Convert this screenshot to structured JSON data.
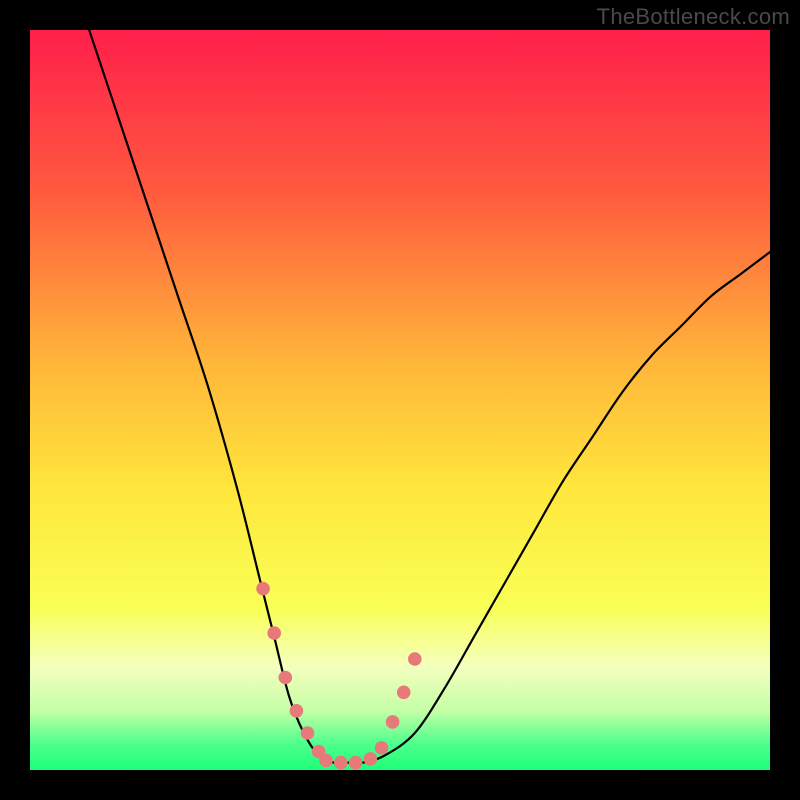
{
  "watermark": "TheBottleneck.com",
  "chart_data": {
    "type": "line",
    "title": "",
    "xlabel": "",
    "ylabel": "",
    "xlim": [
      0,
      100
    ],
    "ylim": [
      0,
      100
    ],
    "series": [
      {
        "name": "bottleneck-curve",
        "x": [
          8,
          12,
          16,
          20,
          24,
          28,
          31,
          33,
          35,
          37,
          39,
          41,
          43,
          45,
          48,
          52,
          56,
          60,
          64,
          68,
          72,
          76,
          80,
          84,
          88,
          92,
          96,
          100
        ],
        "y": [
          100,
          88,
          76,
          64,
          52,
          38,
          26,
          18,
          10,
          5,
          2,
          1,
          1,
          1,
          2,
          5,
          11,
          18,
          25,
          32,
          39,
          45,
          51,
          56,
          60,
          64,
          67,
          70
        ]
      }
    ],
    "markers": {
      "name": "highlight-dots",
      "x": [
        31.5,
        33.0,
        34.5,
        36.0,
        37.5,
        39.0,
        40.0,
        42.0,
        44.0,
        46.0,
        47.5,
        49.0,
        50.5,
        52.0
      ],
      "y": [
        24.5,
        18.5,
        12.5,
        8.0,
        5.0,
        2.5,
        1.3,
        1.0,
        1.0,
        1.5,
        3.0,
        6.5,
        10.5,
        15.0
      ]
    },
    "gradient_stops": [
      {
        "offset": 0.0,
        "color": "#ff1f4b"
      },
      {
        "offset": 0.22,
        "color": "#ff5a3e"
      },
      {
        "offset": 0.45,
        "color": "#ffb63a"
      },
      {
        "offset": 0.62,
        "color": "#ffe63c"
      },
      {
        "offset": 0.78,
        "color": "#f9ff55"
      },
      {
        "offset": 0.86,
        "color": "#f4ffbe"
      },
      {
        "offset": 0.92,
        "color": "#c4ffa6"
      },
      {
        "offset": 0.965,
        "color": "#4dff8c"
      },
      {
        "offset": 1.0,
        "color": "#1eff77"
      }
    ],
    "marker_color": "#e77a79"
  }
}
